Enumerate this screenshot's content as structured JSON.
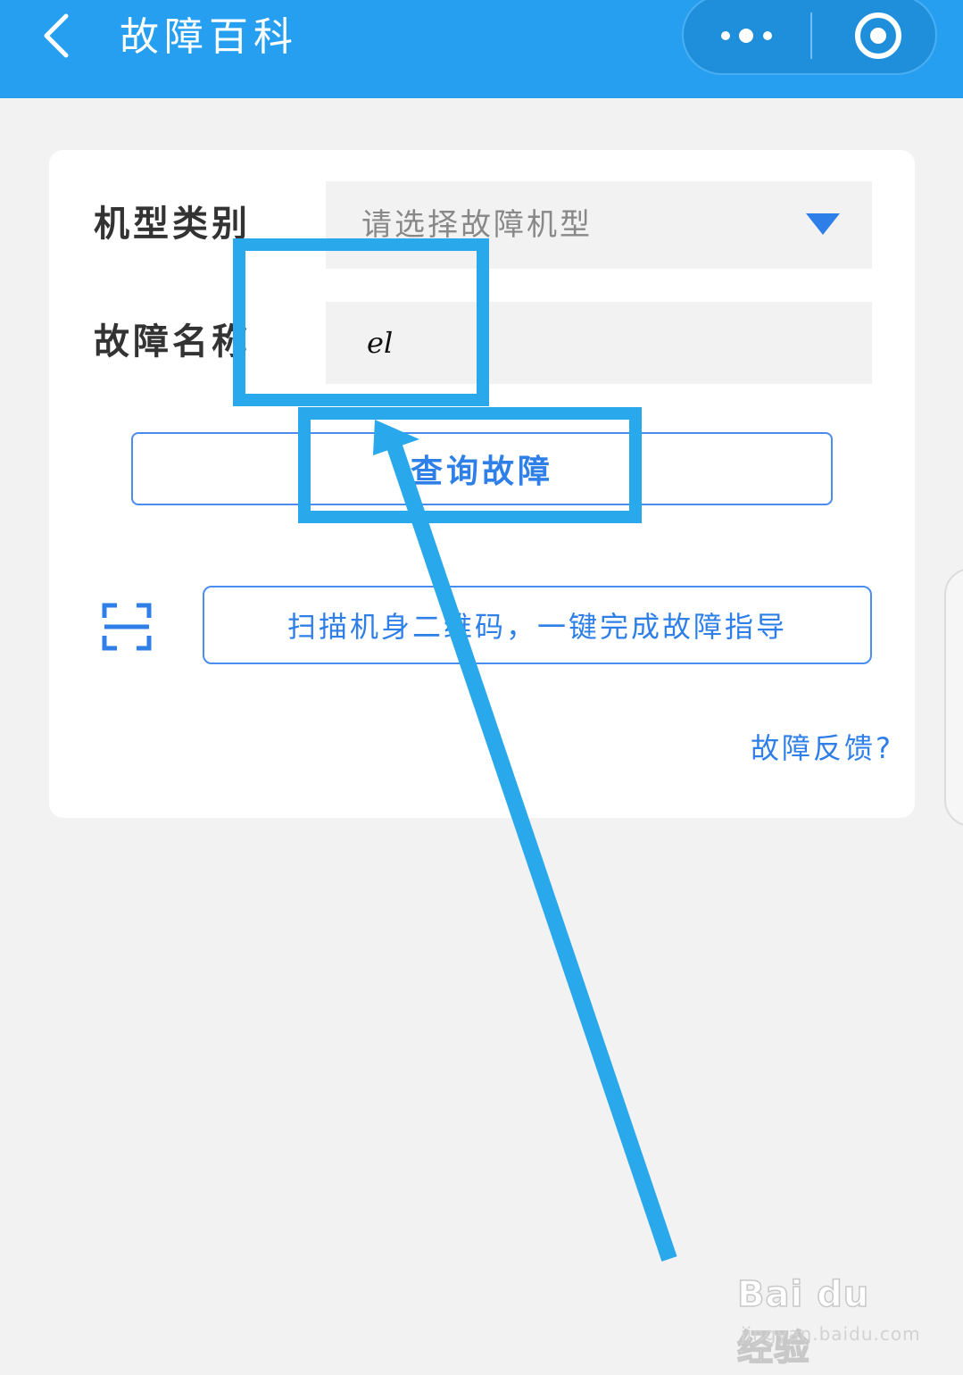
{
  "header": {
    "title": "故障百科",
    "background_color": "#279ff0"
  },
  "form": {
    "model_label": "机型类别",
    "model_placeholder": "请选择故障机型",
    "fault_label": "故障名称",
    "fault_value": "el",
    "query_button": "查询故障",
    "scan_button": "扫描机身二维码，一键完成故障指导",
    "feedback_link": "故障反馈?"
  },
  "icons": {
    "back": "chevron-left-icon",
    "more": "more-dots-icon",
    "close": "target-circle-icon",
    "dropdown": "triangle-down-icon",
    "scan": "scan-frame-icon"
  },
  "colors": {
    "accent": "#2e7fe8",
    "annotation": "#29a8ec",
    "page_background": "#f2f2f2"
  },
  "watermark": {
    "logo": "Bai du 经验",
    "url": "jingyan.baidu.com"
  }
}
